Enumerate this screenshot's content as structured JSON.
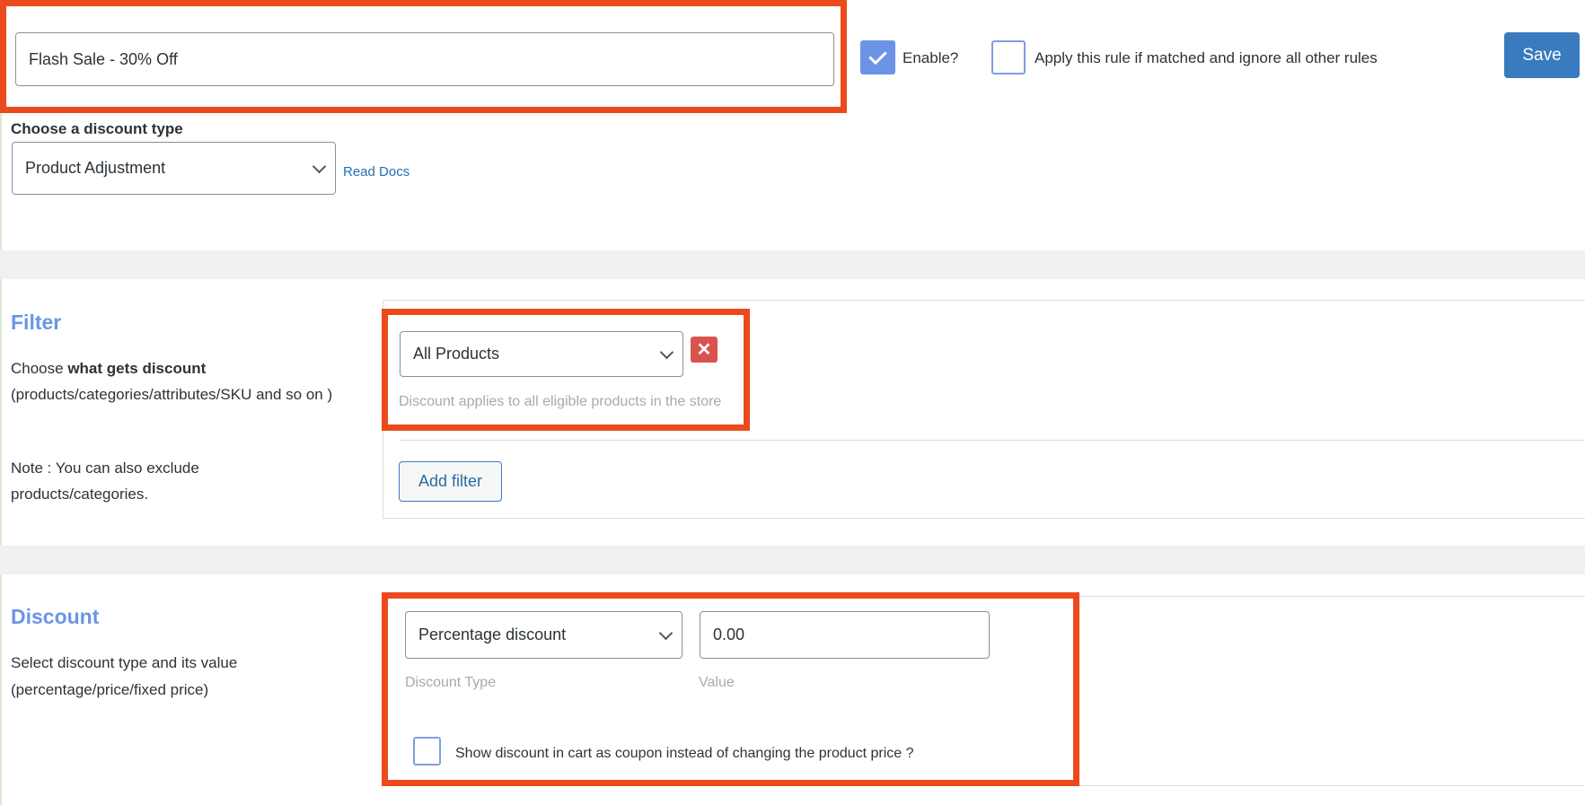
{
  "rule": {
    "title_value": "Flash Sale - 30% Off",
    "enable_label": "Enable?",
    "enable_checked": true,
    "exclusive_label": "Apply this rule if matched and ignore all other rules",
    "exclusive_checked": false,
    "save_label": "Save"
  },
  "discount_type": {
    "label": "Choose a discount type",
    "selected": "Product Adjustment",
    "read_docs": "Read Docs"
  },
  "filter": {
    "heading": "Filter",
    "desc_prefix": "Choose ",
    "desc_bold": "what gets discount",
    "desc_rest": "(products/categories/attributes/SKU and so on )",
    "note": "Note : You can also exclude products/categories.",
    "selected": "All Products",
    "remove_icon": "close-icon",
    "hint": "Discount applies to all eligible products in the store",
    "add_filter_label": "Add filter"
  },
  "discount": {
    "heading": "Discount",
    "desc": "Select discount type and its value (percentage/price/fixed price)",
    "type_selected": "Percentage discount",
    "value": "0.00",
    "type_label": "Discount Type",
    "value_label": "Value",
    "coupon_label": "Show discount in cart as coupon instead of changing the product price ?",
    "coupon_checked": false
  },
  "colors": {
    "highlight": "#ec4a1c",
    "accent": "#6b94e6",
    "save": "#3a7bbf",
    "remove": "#d9534f"
  }
}
